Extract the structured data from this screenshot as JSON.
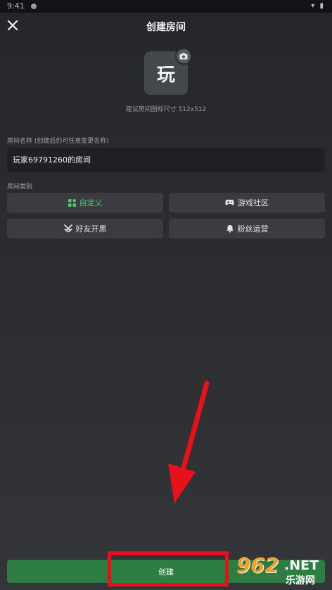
{
  "status_bar": {
    "time": "9:41"
  },
  "header": {
    "title": "创建房间"
  },
  "avatar": {
    "char": "玩",
    "hint": "建议房间图标尺寸 512x512"
  },
  "name_field": {
    "label": "房间名称 (创建后仍可任意变更名称)",
    "value": "玩家69791260的房间"
  },
  "category": {
    "label": "房间类别",
    "options": [
      {
        "label": "自定义",
        "icon": "grid-icon",
        "active": true
      },
      {
        "label": "游戏社区",
        "icon": "gamepad-icon",
        "active": false
      },
      {
        "label": "好友开黑",
        "icon": "crossed-swords-icon",
        "active": false
      },
      {
        "label": "粉丝运营",
        "icon": "bell-icon",
        "active": false
      }
    ]
  },
  "footer": {
    "create_label": "创建"
  },
  "watermark": {
    "number": "962",
    "domain": ".NET",
    "text": "乐游网"
  },
  "colors": {
    "accent": "#4fc66a",
    "create_bg": "#2e7d43",
    "annotation_red": "#e8111b"
  }
}
